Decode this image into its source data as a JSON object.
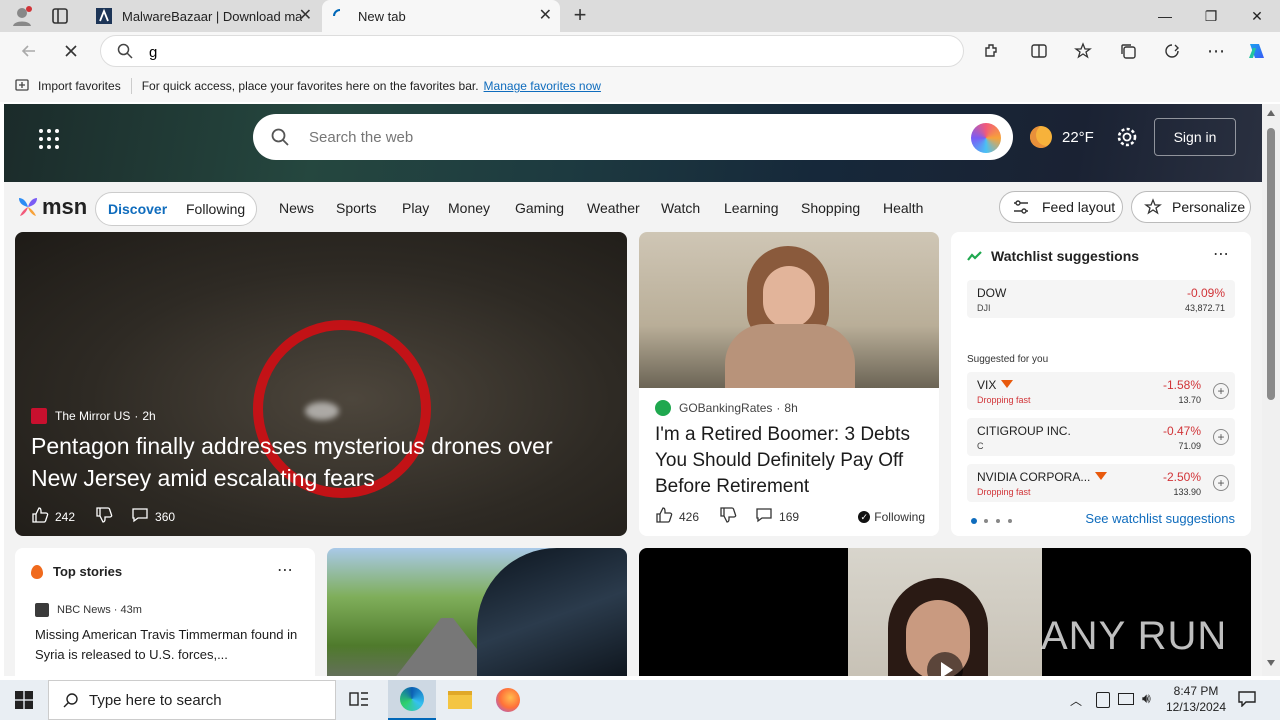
{
  "tabs": [
    {
      "title": "MalwareBazaar | Download malw",
      "active": false
    },
    {
      "title": "New tab",
      "active": true
    }
  ],
  "address": {
    "value": "g"
  },
  "favorites_bar": {
    "import_label": "Import favorites",
    "hint": "For quick access, place your favorites here on the favorites bar.",
    "manage_link": "Manage favorites now"
  },
  "msn": {
    "search_placeholder": "Search the web",
    "weather_temp": "22°F",
    "sign_in": "Sign in",
    "logo": "msn",
    "pill_discover": "Discover",
    "pill_following": "Following",
    "nav": [
      "News",
      "Sports",
      "Play",
      "Money",
      "Gaming",
      "Weather",
      "Watch",
      "Learning",
      "Shopping",
      "Health"
    ],
    "feed_layout": "Feed layout",
    "personalize": "Personalize",
    "hero_card": {
      "source": "The Mirror US",
      "age": "2h",
      "headline": "Pentagon finally addresses mysterious drones over New Jersey amid escalating fears",
      "likes": "242",
      "comments": "360"
    },
    "article_card": {
      "source": "GOBankingRates",
      "age": "8h",
      "headline": "I'm a Retired Boomer: 3 Debts You Should Definitely Pay Off Before Retirement",
      "likes": "426",
      "comments": "169",
      "following": "Following"
    },
    "watchlist": {
      "title": "Watchlist suggestions",
      "dow": {
        "name": "DOW",
        "sub": "DJI",
        "change": "-0.09%",
        "value": "43,872.71"
      },
      "suggested_label": "Suggested for you",
      "items": [
        {
          "name": "VIX",
          "sub": "Dropping fast",
          "change": "-1.58%",
          "value": "13.70"
        },
        {
          "name": "CITIGROUP INC.",
          "sub": "C",
          "change": "-0.47%",
          "value": "71.09"
        },
        {
          "name": "NVIDIA CORPORA...",
          "sub": "Dropping fast",
          "change": "-2.50%",
          "value": "133.90"
        }
      ],
      "see_link": "See watchlist suggestions"
    },
    "top_stories": {
      "title": "Top stories",
      "source": "NBC News",
      "age": "43m",
      "headline": "Missing American Travis Timmerman found in Syria is released to U.S. forces,..."
    },
    "watermark": "ANY RUN"
  },
  "taskbar": {
    "search_placeholder": "Type here to search",
    "time": "8:47 PM",
    "date": "12/13/2024"
  },
  "colors": {
    "accent": "#0067b8",
    "negative": "#d13438",
    "link": "#0f6cbd"
  }
}
